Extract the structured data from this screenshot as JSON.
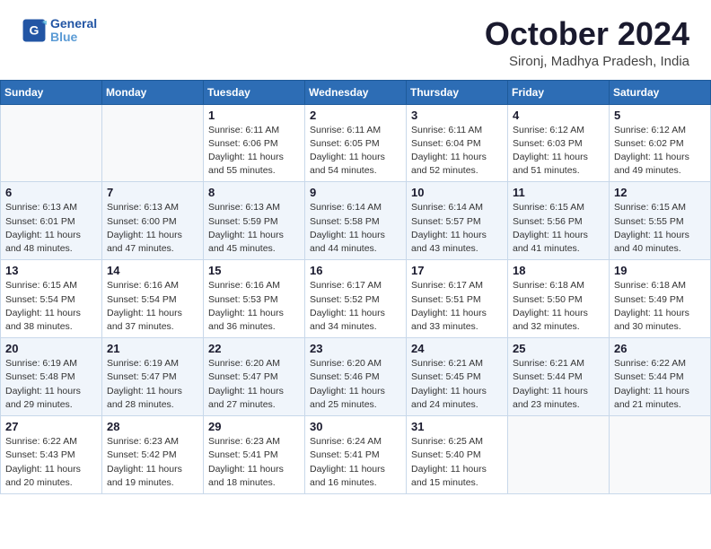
{
  "header": {
    "logo_line1": "General",
    "logo_line2": "Blue",
    "title": "October 2024",
    "location": "Sironj, Madhya Pradesh, India"
  },
  "weekdays": [
    "Sunday",
    "Monday",
    "Tuesday",
    "Wednesday",
    "Thursday",
    "Friday",
    "Saturday"
  ],
  "weeks": [
    [
      {
        "day": "",
        "sunrise": "",
        "sunset": "",
        "daylight": ""
      },
      {
        "day": "",
        "sunrise": "",
        "sunset": "",
        "daylight": ""
      },
      {
        "day": "1",
        "sunrise": "Sunrise: 6:11 AM",
        "sunset": "Sunset: 6:06 PM",
        "daylight": "Daylight: 11 hours and 55 minutes."
      },
      {
        "day": "2",
        "sunrise": "Sunrise: 6:11 AM",
        "sunset": "Sunset: 6:05 PM",
        "daylight": "Daylight: 11 hours and 54 minutes."
      },
      {
        "day": "3",
        "sunrise": "Sunrise: 6:11 AM",
        "sunset": "Sunset: 6:04 PM",
        "daylight": "Daylight: 11 hours and 52 minutes."
      },
      {
        "day": "4",
        "sunrise": "Sunrise: 6:12 AM",
        "sunset": "Sunset: 6:03 PM",
        "daylight": "Daylight: 11 hours and 51 minutes."
      },
      {
        "day": "5",
        "sunrise": "Sunrise: 6:12 AM",
        "sunset": "Sunset: 6:02 PM",
        "daylight": "Daylight: 11 hours and 49 minutes."
      }
    ],
    [
      {
        "day": "6",
        "sunrise": "Sunrise: 6:13 AM",
        "sunset": "Sunset: 6:01 PM",
        "daylight": "Daylight: 11 hours and 48 minutes."
      },
      {
        "day": "7",
        "sunrise": "Sunrise: 6:13 AM",
        "sunset": "Sunset: 6:00 PM",
        "daylight": "Daylight: 11 hours and 47 minutes."
      },
      {
        "day": "8",
        "sunrise": "Sunrise: 6:13 AM",
        "sunset": "Sunset: 5:59 PM",
        "daylight": "Daylight: 11 hours and 45 minutes."
      },
      {
        "day": "9",
        "sunrise": "Sunrise: 6:14 AM",
        "sunset": "Sunset: 5:58 PM",
        "daylight": "Daylight: 11 hours and 44 minutes."
      },
      {
        "day": "10",
        "sunrise": "Sunrise: 6:14 AM",
        "sunset": "Sunset: 5:57 PM",
        "daylight": "Daylight: 11 hours and 43 minutes."
      },
      {
        "day": "11",
        "sunrise": "Sunrise: 6:15 AM",
        "sunset": "Sunset: 5:56 PM",
        "daylight": "Daylight: 11 hours and 41 minutes."
      },
      {
        "day": "12",
        "sunrise": "Sunrise: 6:15 AM",
        "sunset": "Sunset: 5:55 PM",
        "daylight": "Daylight: 11 hours and 40 minutes."
      }
    ],
    [
      {
        "day": "13",
        "sunrise": "Sunrise: 6:15 AM",
        "sunset": "Sunset: 5:54 PM",
        "daylight": "Daylight: 11 hours and 38 minutes."
      },
      {
        "day": "14",
        "sunrise": "Sunrise: 6:16 AM",
        "sunset": "Sunset: 5:54 PM",
        "daylight": "Daylight: 11 hours and 37 minutes."
      },
      {
        "day": "15",
        "sunrise": "Sunrise: 6:16 AM",
        "sunset": "Sunset: 5:53 PM",
        "daylight": "Daylight: 11 hours and 36 minutes."
      },
      {
        "day": "16",
        "sunrise": "Sunrise: 6:17 AM",
        "sunset": "Sunset: 5:52 PM",
        "daylight": "Daylight: 11 hours and 34 minutes."
      },
      {
        "day": "17",
        "sunrise": "Sunrise: 6:17 AM",
        "sunset": "Sunset: 5:51 PM",
        "daylight": "Daylight: 11 hours and 33 minutes."
      },
      {
        "day": "18",
        "sunrise": "Sunrise: 6:18 AM",
        "sunset": "Sunset: 5:50 PM",
        "daylight": "Daylight: 11 hours and 32 minutes."
      },
      {
        "day": "19",
        "sunrise": "Sunrise: 6:18 AM",
        "sunset": "Sunset: 5:49 PM",
        "daylight": "Daylight: 11 hours and 30 minutes."
      }
    ],
    [
      {
        "day": "20",
        "sunrise": "Sunrise: 6:19 AM",
        "sunset": "Sunset: 5:48 PM",
        "daylight": "Daylight: 11 hours and 29 minutes."
      },
      {
        "day": "21",
        "sunrise": "Sunrise: 6:19 AM",
        "sunset": "Sunset: 5:47 PM",
        "daylight": "Daylight: 11 hours and 28 minutes."
      },
      {
        "day": "22",
        "sunrise": "Sunrise: 6:20 AM",
        "sunset": "Sunset: 5:47 PM",
        "daylight": "Daylight: 11 hours and 27 minutes."
      },
      {
        "day": "23",
        "sunrise": "Sunrise: 6:20 AM",
        "sunset": "Sunset: 5:46 PM",
        "daylight": "Daylight: 11 hours and 25 minutes."
      },
      {
        "day": "24",
        "sunrise": "Sunrise: 6:21 AM",
        "sunset": "Sunset: 5:45 PM",
        "daylight": "Daylight: 11 hours and 24 minutes."
      },
      {
        "day": "25",
        "sunrise": "Sunrise: 6:21 AM",
        "sunset": "Sunset: 5:44 PM",
        "daylight": "Daylight: 11 hours and 23 minutes."
      },
      {
        "day": "26",
        "sunrise": "Sunrise: 6:22 AM",
        "sunset": "Sunset: 5:44 PM",
        "daylight": "Daylight: 11 hours and 21 minutes."
      }
    ],
    [
      {
        "day": "27",
        "sunrise": "Sunrise: 6:22 AM",
        "sunset": "Sunset: 5:43 PM",
        "daylight": "Daylight: 11 hours and 20 minutes."
      },
      {
        "day": "28",
        "sunrise": "Sunrise: 6:23 AM",
        "sunset": "Sunset: 5:42 PM",
        "daylight": "Daylight: 11 hours and 19 minutes."
      },
      {
        "day": "29",
        "sunrise": "Sunrise: 6:23 AM",
        "sunset": "Sunset: 5:41 PM",
        "daylight": "Daylight: 11 hours and 18 minutes."
      },
      {
        "day": "30",
        "sunrise": "Sunrise: 6:24 AM",
        "sunset": "Sunset: 5:41 PM",
        "daylight": "Daylight: 11 hours and 16 minutes."
      },
      {
        "day": "31",
        "sunrise": "Sunrise: 6:25 AM",
        "sunset": "Sunset: 5:40 PM",
        "daylight": "Daylight: 11 hours and 15 minutes."
      },
      {
        "day": "",
        "sunrise": "",
        "sunset": "",
        "daylight": ""
      },
      {
        "day": "",
        "sunrise": "",
        "sunset": "",
        "daylight": ""
      }
    ]
  ]
}
